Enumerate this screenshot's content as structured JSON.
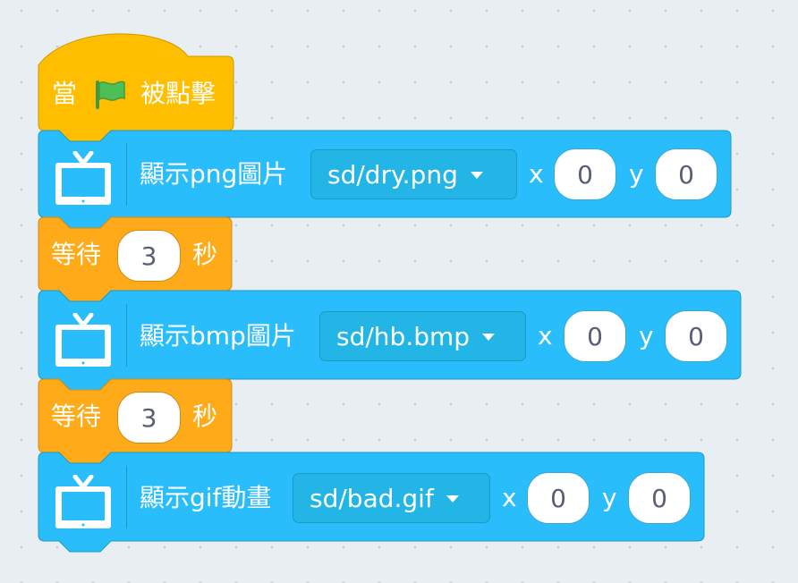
{
  "colors": {
    "workspace_bg": "#e9eef2",
    "event_block": "#ffbf00",
    "event_border": "#cc9900",
    "control_block": "#ffab19",
    "control_border": "#cf8b17",
    "display_block": "#29befb",
    "display_border": "#1a99c4",
    "flag_green": "#4cbf56"
  },
  "blocks": {
    "hat": {
      "prefix": "當",
      "flag_icon": "green-flag-icon",
      "suffix": "被點擊"
    },
    "show_png": {
      "icon": "tv-icon",
      "label": "顯示png圖片",
      "dropdown_value": "sd/dry.png",
      "x_label": "x",
      "x_value": "0",
      "y_label": "y",
      "y_value": "0"
    },
    "wait_1": {
      "label": "等待",
      "seconds": "3",
      "unit": "秒"
    },
    "show_bmp": {
      "icon": "tv-icon",
      "label": "顯示bmp圖片",
      "dropdown_value": "sd/hb.bmp",
      "x_label": "x",
      "x_value": "0",
      "y_label": "y",
      "y_value": "0"
    },
    "wait_2": {
      "label": "等待",
      "seconds": "3",
      "unit": "秒"
    },
    "show_gif": {
      "icon": "tv-icon",
      "label": "顯示gif動畫",
      "dropdown_value": "sd/bad.gif",
      "x_label": "x",
      "x_value": "0",
      "y_label": "y",
      "y_value": "0"
    }
  }
}
